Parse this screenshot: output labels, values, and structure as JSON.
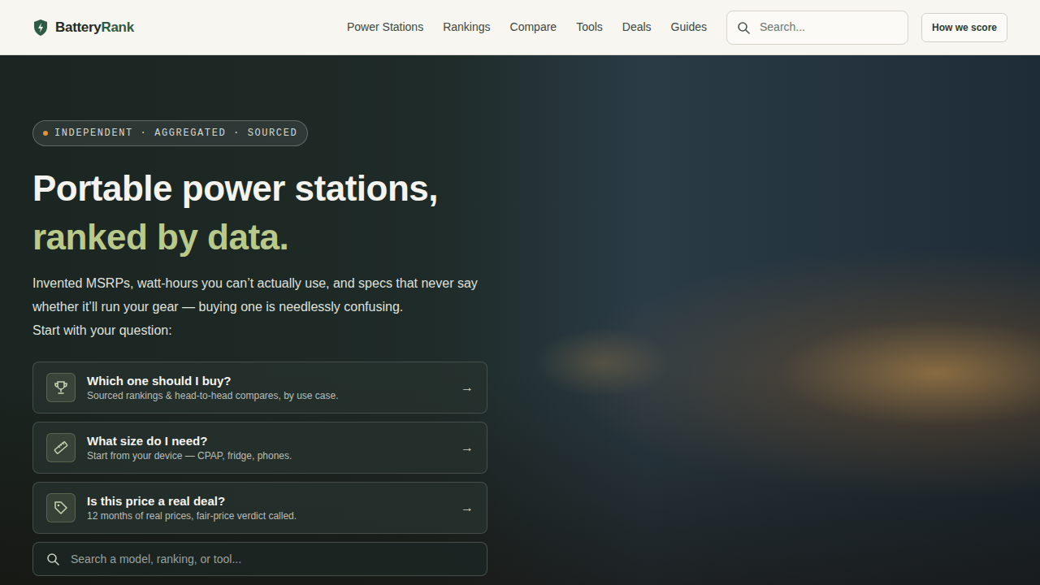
{
  "nav": {
    "logo": {
      "part1": "Battery",
      "part2": "Rank"
    },
    "links": [
      "Power Stations",
      "Rankings",
      "Compare",
      "Tools",
      "Deals",
      "Guides"
    ],
    "search": {
      "placeholder": "Search..."
    },
    "button": "How we score"
  },
  "hero": {
    "badge": "INDEPENDENT · AGGREGATED · SOURCED",
    "title_line1": "Portable power stations,",
    "title_line2": "ranked by data.",
    "intro": "Invented MSRPs, watt-hours you can’t actually use, and specs that never say whether it’ll run your gear — buying one is needlessly confusing.",
    "prompt": "Start with your question:",
    "cards": [
      {
        "title": "Which one should I buy?",
        "subtitle": "Sourced rankings & head-to-head compares, by use case.",
        "arrow": "→"
      },
      {
        "title": "What size do I need?",
        "subtitle": "Start from your device — CPAP, fridge, phones.",
        "arrow": "→"
      },
      {
        "title": "Is this price a real deal?",
        "subtitle": "12 months of real prices, fair-price verdict called.",
        "arrow": "→"
      }
    ],
    "search": {
      "placeholder": "Search a model, ranking, or tool..."
    }
  }
}
